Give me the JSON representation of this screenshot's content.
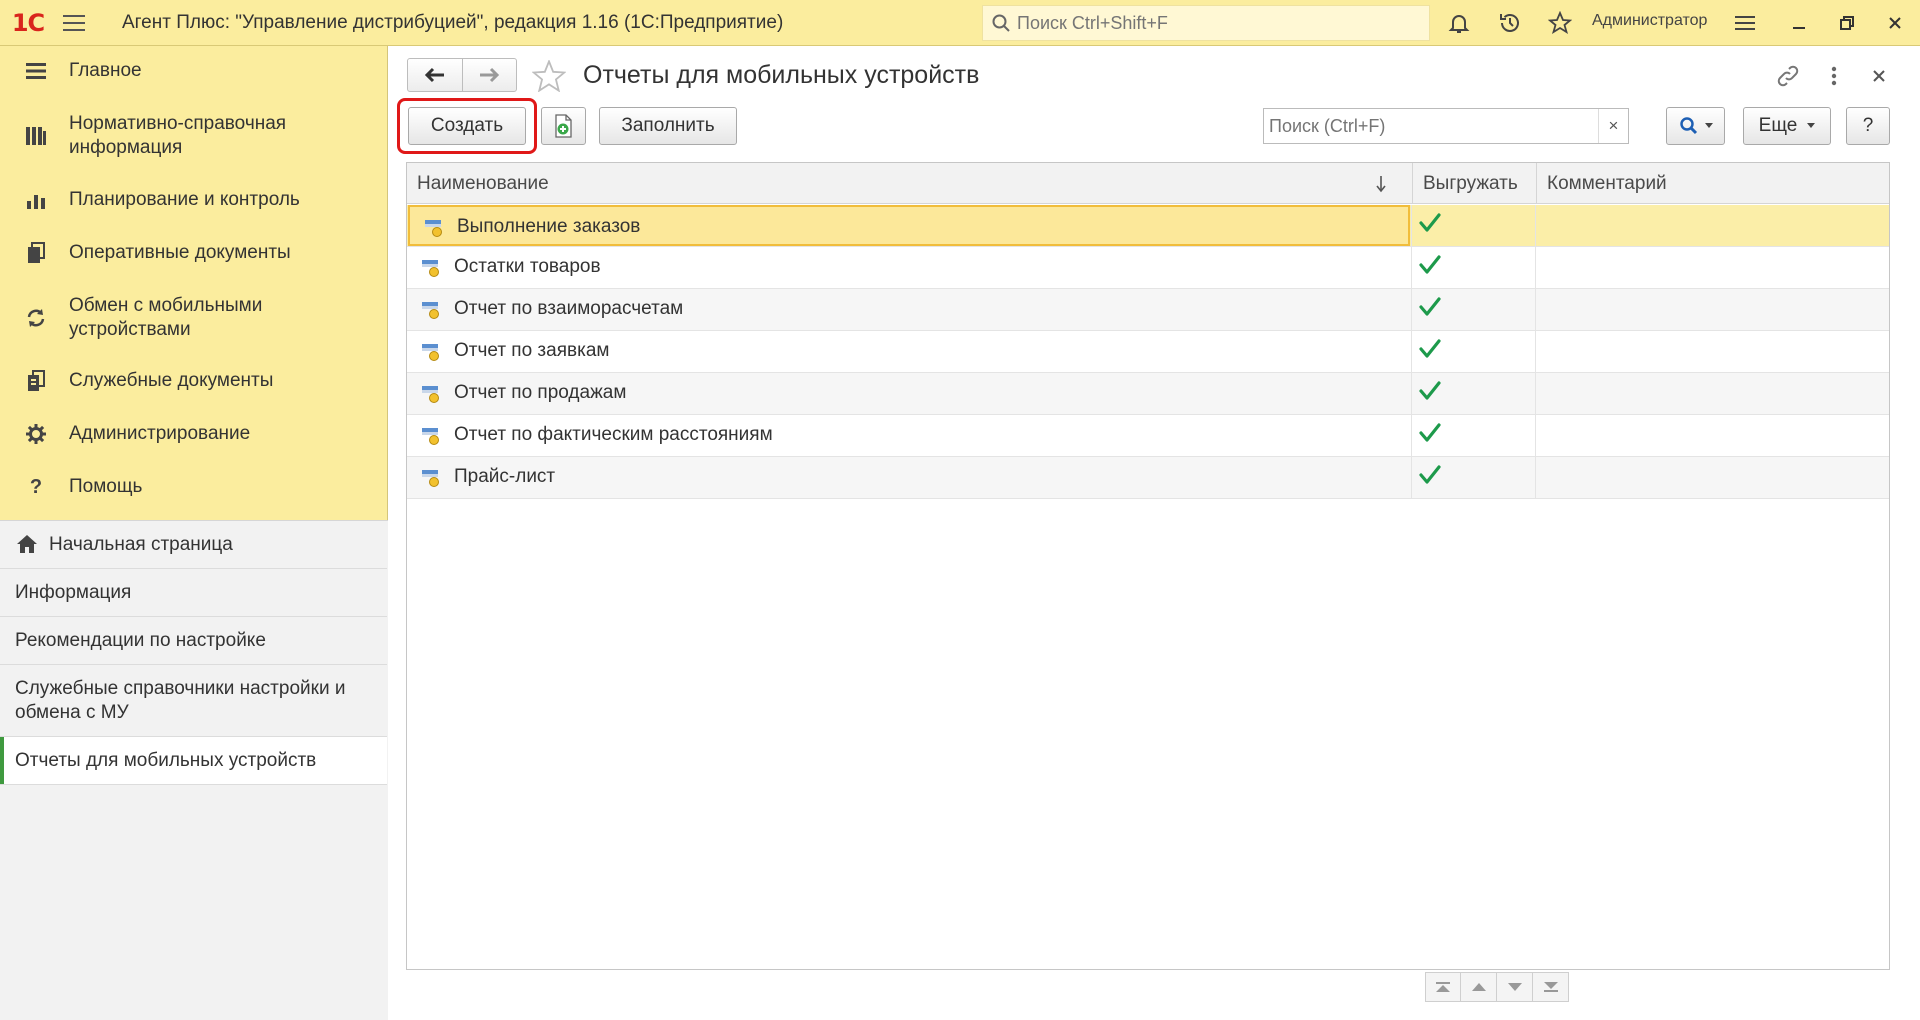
{
  "titlebar": {
    "logo_text": "1С",
    "title": "Агент Плюс: \"Управление дистрибуцией\", редакция 1.16  (1С:Предприятие)",
    "search_placeholder": "Поиск Ctrl+Shift+F",
    "user": "Администратор"
  },
  "sidebar": {
    "items": [
      {
        "label": "Главное",
        "icon": "menu-lines-icon"
      },
      {
        "label": "Нормативно-справочная информация",
        "icon": "catalog-icon"
      },
      {
        "label": "Планирование и контроль",
        "icon": "bar-chart-icon"
      },
      {
        "label": "Оперативные документы",
        "icon": "documents-icon"
      },
      {
        "label": "Обмен с мобильными устройствами",
        "icon": "sync-icon"
      },
      {
        "label": "Служебные документы",
        "icon": "service-docs-icon"
      },
      {
        "label": "Администрирование",
        "icon": "gear-icon"
      },
      {
        "label": "Помощь",
        "icon": "question-icon"
      }
    ],
    "sub_items": [
      {
        "label": "Начальная страница",
        "icon": "home-icon"
      },
      {
        "label": "Информация"
      },
      {
        "label": "Рекомендации по настройке"
      },
      {
        "label": "Служебные справочники настройки и обмена с МУ"
      },
      {
        "label": "Отчеты для мобильных устройств"
      }
    ]
  },
  "form": {
    "title": "Отчеты для мобильных устройств",
    "toolbar": {
      "create_label": "Создать",
      "fill_label": "Заполнить",
      "search_placeholder": "Поиск (Ctrl+F)",
      "search_clear": "×",
      "more_label": "Еще",
      "help_label": "?"
    },
    "table": {
      "columns": [
        "Наименование",
        "Выгружать",
        "Комментарий"
      ],
      "rows": [
        {
          "name": "Выполнение заказов",
          "export": true,
          "comment": ""
        },
        {
          "name": "Остатки товаров",
          "export": true,
          "comment": ""
        },
        {
          "name": "Отчет по взаиморасчетам",
          "export": true,
          "comment": ""
        },
        {
          "name": "Отчет по заявкам",
          "export": true,
          "comment": ""
        },
        {
          "name": "Отчет по продажам",
          "export": true,
          "comment": ""
        },
        {
          "name": "Отчет по фактическим расстояниям",
          "export": true,
          "comment": ""
        },
        {
          "name": "Прайс-лист",
          "export": true,
          "comment": ""
        }
      ]
    }
  },
  "colors": {
    "panel_yellow": "#fbed9e",
    "selected_row": "#fce89a",
    "check_green": "#1d9a4b",
    "highlight_red": "#e01818",
    "active_marker": "#3f9a3f"
  }
}
